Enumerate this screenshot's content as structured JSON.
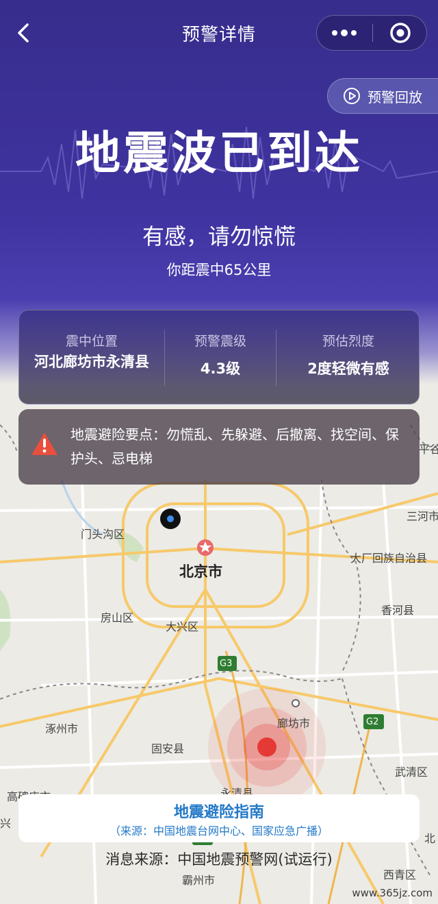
{
  "header": {
    "title": "预警详情",
    "back_icon": "chevron-left-icon",
    "more_icon": "more-dots-icon",
    "close_icon": "target-circle-icon"
  },
  "replay": {
    "label": "预警回放",
    "icon": "play-circle-icon"
  },
  "alert": {
    "headline": "地震波已到达",
    "subline": "有感，请勿惊慌",
    "distance": "你距震中65公里"
  },
  "info": {
    "epicenter_label": "震中位置",
    "epicenter_value": "河北廊坊市永清县",
    "magnitude_label": "预警震级",
    "magnitude_value": "4.3级",
    "intensity_label": "预估烈度",
    "intensity_value": "2度轻微有感"
  },
  "tips": {
    "icon": "warning-triangle-icon",
    "text": "地震避险要点：勿慌乱、先躲避、后撤离、找空间、保护头、忌电梯"
  },
  "map": {
    "labels": {
      "beijing": "北京市",
      "mentougou": "门头沟区",
      "fangshan": "房山区",
      "daxing": "大兴区",
      "langfang": "廊坊市",
      "zhuozhou": "涿州市",
      "guan": "固安县",
      "yongqing": "永清县",
      "dachang": "大厂回族自治县",
      "sanhe": "三河市",
      "xianghe": "香河县",
      "wuqing": "武清区",
      "gaobeidian": "高碑店市",
      "bazhou": "霸州市",
      "xiqing": "西青区",
      "pinggu": "平谷",
      "north_edge": "北",
      "xiong": "兴"
    },
    "shields": {
      "g3": "G3",
      "g2": "G2",
      "g18": "G18"
    },
    "colors": {
      "epicenter": "#e53935",
      "location": "#1e88e5"
    }
  },
  "guide": {
    "title": "地震避险指南",
    "subtitle": "（来源：中国地震台网中心、国家应急广播）"
  },
  "source": "消息来源：中国地震预警网(试运行)",
  "watermark": "www.365jz.com"
}
